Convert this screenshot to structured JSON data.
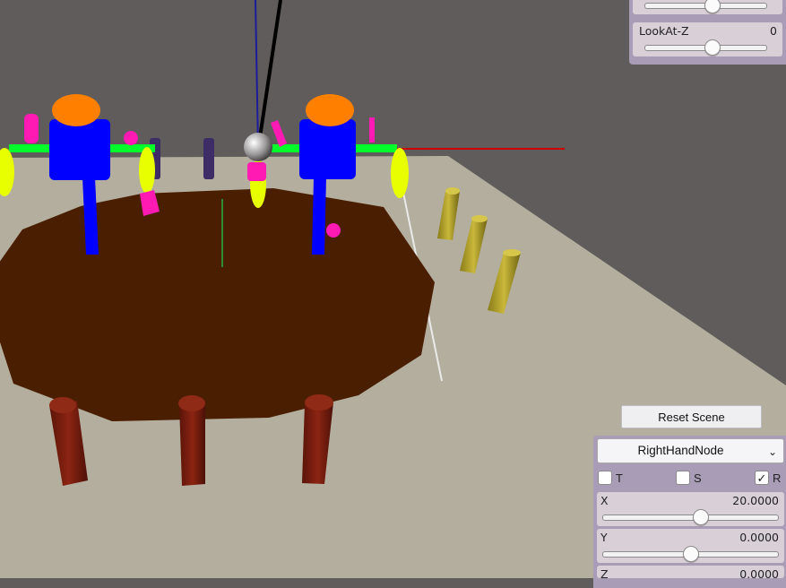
{
  "camera_panel": {
    "lookat_y_thumb_fraction": 0.5,
    "lookat_z": {
      "label": "LookAt-Z",
      "value": "0",
      "thumb_fraction": 0.5
    }
  },
  "reset_button": {
    "label": "Reset Scene"
  },
  "transform_panel": {
    "node_select": {
      "selected": "RightHandNode",
      "chevron": "chevron-down-icon"
    },
    "toggles": [
      {
        "label": "T",
        "checked": false
      },
      {
        "label": "S",
        "checked": false
      },
      {
        "label": "R",
        "checked": true,
        "mark": "✓"
      }
    ],
    "x": {
      "label": "X",
      "value": "20.0000",
      "thumb_fraction": 0.55
    },
    "y": {
      "label": "Y",
      "value": "0.0000",
      "thumb_fraction": 0.5
    },
    "z": {
      "label": "Z",
      "value": "0.0000"
    }
  },
  "colors": {
    "background": "#5f5c5b",
    "floor": "#b3ae9d",
    "table_top": "#4a1e00",
    "table_legs": "#7a1c0d",
    "robot_body": "#0000ff",
    "robot_head": "#ff8000",
    "robot_arm": "#00ff2a",
    "hands": "#e8ff00",
    "magenta_parts": "#ff1ab4",
    "purple_posts": "#3d2c66",
    "yellow_posts": "#b8a628",
    "panel": "#a99cb6"
  }
}
